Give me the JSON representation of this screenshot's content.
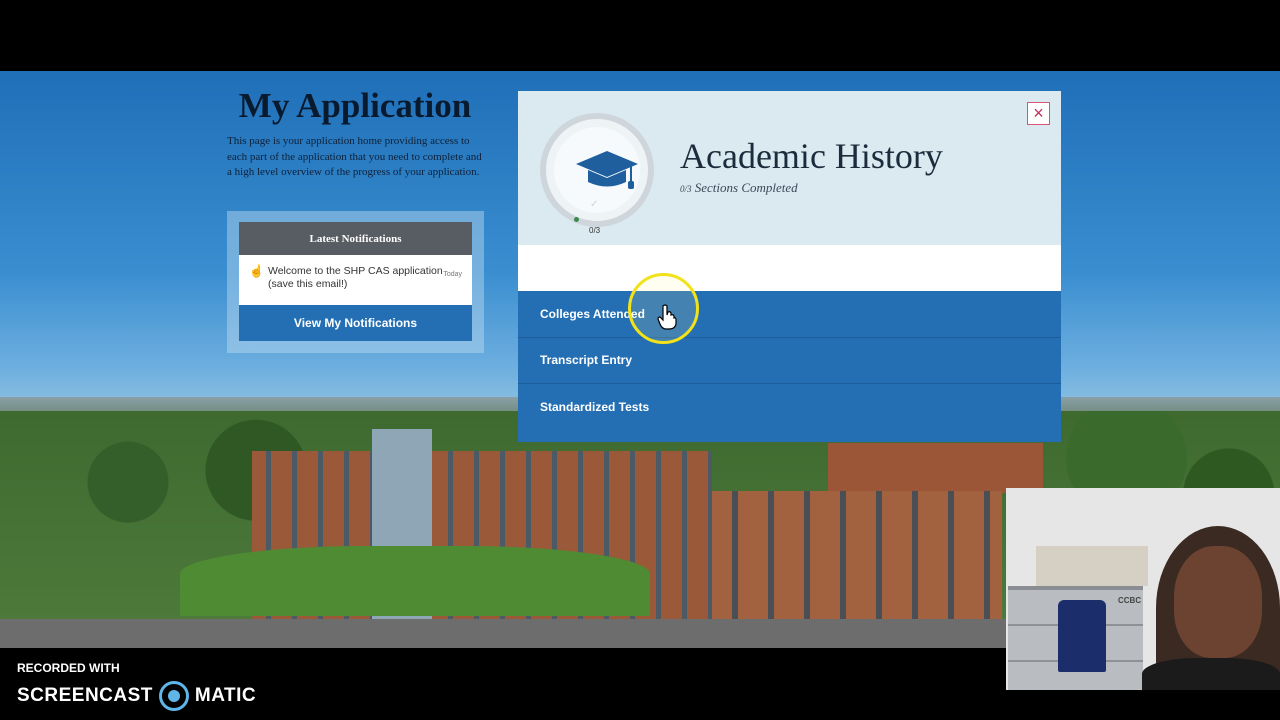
{
  "page": {
    "title": "My Application",
    "description": "This page is your application home providing access to each part of the application that you need to complete and a high level overview of the progress of your application."
  },
  "notifications": {
    "header": "Latest Notifications",
    "items": [
      {
        "text": "Welcome to the SHP CAS application (save this email!)",
        "time": "Today",
        "icon": "hand-wave-icon"
      }
    ],
    "button_label": "View My Notifications"
  },
  "modal": {
    "title": "Academic History",
    "progress_fraction": "0/3",
    "progress_completed": 0,
    "progress_total": 3,
    "sections_completed_label": "Sections Completed",
    "close_icon": "close-icon",
    "header_icon": "graduation-cap-icon",
    "sections": [
      {
        "label": "Colleges Attended"
      },
      {
        "label": "Transcript Entry"
      },
      {
        "label": "Standardized Tests"
      }
    ]
  },
  "webcam": {
    "label": "CCBC"
  },
  "watermark": {
    "line1": "RECORDED WITH",
    "brand_left": "SCREENCAST",
    "brand_right": "MATIC"
  },
  "colors": {
    "primary_blue": "#246fb4",
    "modal_header_bg": "#dbe9f1",
    "close_red": "#c0305a",
    "cursor_highlight": "#f2e21a"
  }
}
